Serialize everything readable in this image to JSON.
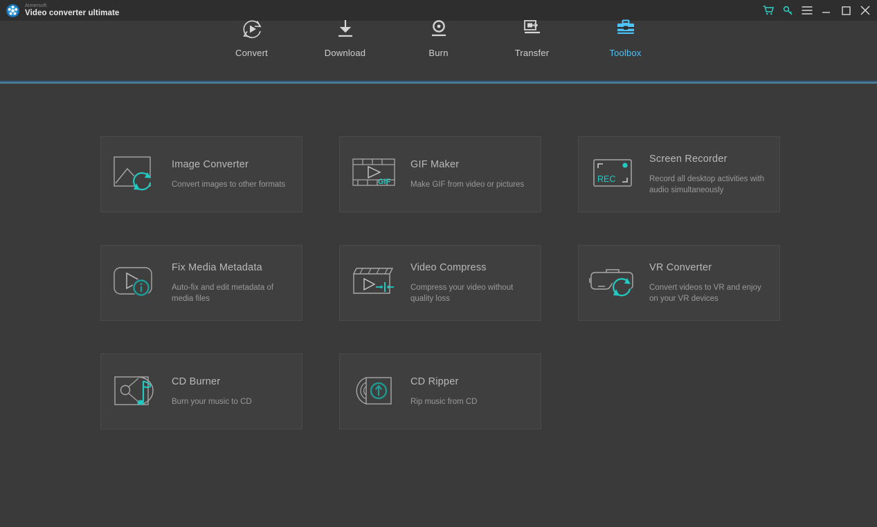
{
  "window": {
    "vendor": "Aimersoft",
    "app_name": "Video converter ultimate",
    "logo_icon": "film-reel-logo-icon",
    "controls": [
      {
        "name": "cart-icon",
        "label": "Cart"
      },
      {
        "name": "key-icon",
        "label": "Register"
      },
      {
        "name": "hamburger-menu-icon",
        "label": "Menu"
      },
      {
        "name": "minimize-icon",
        "label": "Minimize"
      },
      {
        "name": "maximize-icon",
        "label": "Maximize"
      },
      {
        "name": "close-icon",
        "label": "Close"
      }
    ]
  },
  "nav": {
    "active": "Toolbox",
    "accent": "#26c6da",
    "divider_color": "#4a7a96",
    "items": [
      {
        "label": "Convert",
        "icon": "convert-icon",
        "active": false
      },
      {
        "label": "Download",
        "icon": "download-icon",
        "active": false
      },
      {
        "label": "Burn",
        "icon": "burn-icon",
        "active": false
      },
      {
        "label": "Transfer",
        "icon": "transfer-icon",
        "active": false
      },
      {
        "label": "Toolbox",
        "icon": "toolbox-icon",
        "active": true
      }
    ]
  },
  "toolbox": {
    "accent": "#22c9c0",
    "tools": [
      {
        "title": "Image Converter",
        "desc": "Convert images to other formats",
        "icon": "image-converter-icon"
      },
      {
        "title": "GIF Maker",
        "desc": "Make GIF from video or pictures",
        "icon": "gif-maker-icon",
        "badge": "GIF"
      },
      {
        "title": "Screen Recorder",
        "desc": "Record all desktop activities with audio simultaneously",
        "icon": "screen-recorder-icon",
        "badge": "REC"
      },
      {
        "title": "Fix Media Metadata",
        "desc": "Auto-fix and edit metadata of media files",
        "icon": "fix-media-metadata-icon"
      },
      {
        "title": "Video Compress",
        "desc": "Compress your video without quality loss",
        "icon": "video-compress-icon"
      },
      {
        "title": "VR Converter",
        "desc": "Convert videos to VR and enjoy on your VR devices",
        "icon": "vr-converter-icon"
      },
      {
        "title": "CD Burner",
        "desc": "Burn your music to CD",
        "icon": "cd-burner-icon"
      },
      {
        "title": "CD Ripper",
        "desc": "Rip music from CD",
        "icon": "cd-ripper-icon"
      }
    ]
  }
}
